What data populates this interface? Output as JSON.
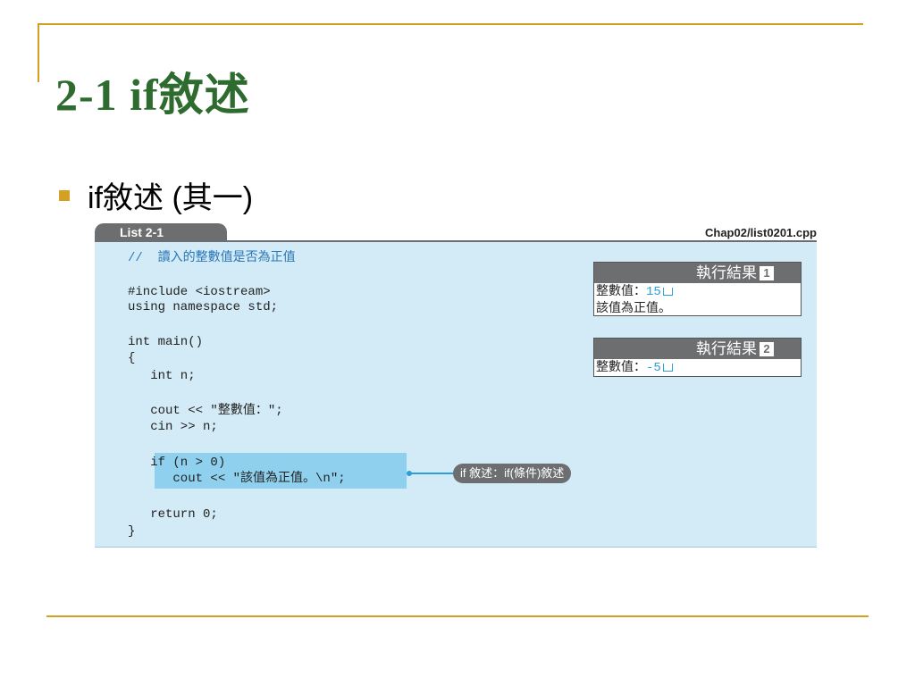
{
  "slide": {
    "title": "2-1  if敘述",
    "bullet": "if敘述 (其一)"
  },
  "listing": {
    "tab_label": "List 2-1",
    "file_name": "Chap02/list0201.cpp",
    "code": [
      "//  讀入的整數值是否為正值",
      "#include <iostream>",
      "using namespace std;",
      "int main()",
      "{",
      "   int n;",
      "   cout << \"整數值：\";",
      "   cin >> n;",
      "   if (n > 0)",
      "      cout << \"該值為正值。\\n\";",
      "   return 0;",
      "}"
    ],
    "callout": "if 敘述：if(條件)敘述"
  },
  "results": [
    {
      "title": "執行結果",
      "number": "1",
      "lines": [
        {
          "prefix": "整數值：",
          "value": "15",
          "enter": true
        },
        {
          "prefix": "該值為正值。",
          "value": "",
          "enter": false
        }
      ]
    },
    {
      "title": "執行結果",
      "number": "2",
      "lines": [
        {
          "prefix": "整數值：",
          "value": "-5",
          "enter": true
        }
      ]
    }
  ],
  "colors": {
    "accent": "#d4a024",
    "title_green": "#2e6b2e",
    "code_bg": "#d3ebf7",
    "highlight": "#8fd0ef",
    "tab_gray": "#6d6e70",
    "value_blue": "#2a9fd8"
  }
}
